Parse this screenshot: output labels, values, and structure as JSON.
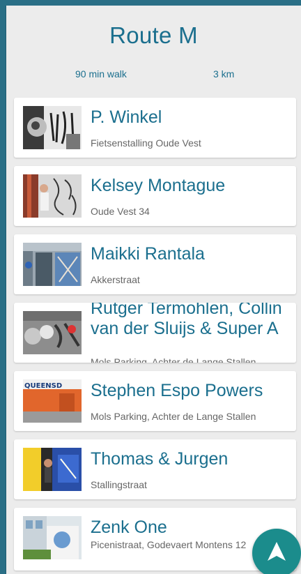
{
  "route": {
    "title": "Route M",
    "duration": "90 min walk",
    "distance": "3 km"
  },
  "stops": [
    {
      "artist": "P. Winkel",
      "location": "Fietsenstalling Oude Vest"
    },
    {
      "artist": "Kelsey Montague",
      "location": "Oude Vest 34"
    },
    {
      "artist": "Maikki Rantala",
      "location": "Akkerstraat"
    },
    {
      "artist": "Rutger Termohlen, Collin van der Sluijs & Super A",
      "location": "Mols Parking, Achter de Lange Stallen"
    },
    {
      "artist": "Stephen Espo Powers",
      "location": "Mols Parking, Achter de Lange Stallen",
      "thumb_text": "QUEENSD"
    },
    {
      "artist": "Thomas & Jurgen",
      "location": "Stallingstraat"
    },
    {
      "artist": "Zenk One",
      "location": "Picenistraat, Godevaert Montens 12"
    }
  ],
  "colors": {
    "accent": "#1b6f8e",
    "fab": "#1b8c8c",
    "frame": "#2a6f86"
  },
  "fab_icon": "navigation-arrow-icon"
}
